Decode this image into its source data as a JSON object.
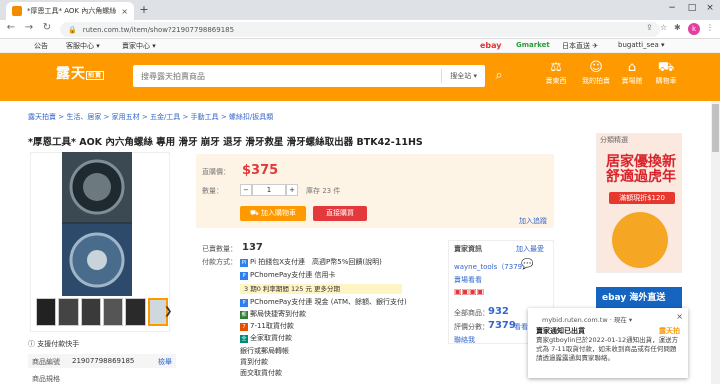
{
  "browser": {
    "tab_title": "*厚恩工具* AOK 內六角螺絲 專用",
    "tab_close": "×",
    "new_tab": "+",
    "url": "ruten.com.tw/item/show?21907798869185",
    "profile_initial": "k",
    "win_min": "−",
    "win_max": "□",
    "win_close": "×"
  },
  "topbar": {
    "links": [
      "公告",
      "客服中心 ▾",
      "賣家中心 ▾"
    ],
    "partners": [
      "ebay",
      "Gmarket",
      "日本直送 ✈",
      "bugatti_sea ▾"
    ]
  },
  "header": {
    "logo": "露天",
    "logo_tag": "拍賣",
    "search_placeholder": "搜尋露天拍賣商品",
    "search_scope": "搜全站 ▾",
    "nav": [
      {
        "icon": "gavel-icon",
        "glyph": "⚖",
        "label": "賣東西"
      },
      {
        "icon": "user-icon",
        "glyph": "☺",
        "label": "我的拍賣"
      },
      {
        "icon": "store-icon",
        "glyph": "⌂",
        "label": "賣場館"
      },
      {
        "icon": "cart-icon",
        "glyph": "⛟",
        "label": "購物車"
      }
    ]
  },
  "breadcrumb": "露天拍賣 > 生活、居家 > 家用五材 > 五金/工具 > 手動工具 > 螺絲扣/扳具類",
  "product": {
    "title": "*厚恩工具* AOK 內六角螺絲 專用 滑牙 崩牙 退牙 滑牙救星 滑牙螺絲取出器 BTK42-11HS",
    "price_label": "直購價：",
    "price": "$375",
    "qty_label": "數量：",
    "qty_minus": "−",
    "qty_value": "1",
    "qty_plus": "+",
    "stock": "庫存 23 件",
    "add_cart": "加入購物車",
    "buy_now": "直接購買",
    "track": "加入追蹤",
    "sold_label": "已賣數量：",
    "sold": "137",
    "pay_label": "付款方式：",
    "payments": [
      "Pi 拍錢包X支付連　高週P幣5%回饋(說明)",
      "PChomePay支付連 信用卡",
      "PChomePay支付連 現金 (ATM、餘額、銀行支付)",
      "郵局快捷寄到付款",
      "7-11取貨付款",
      "全家取貨付款",
      "銀行或郵局轉帳",
      "貨到付款",
      "面交取貨付款"
    ],
    "installment": "3 期0 利率期間 125 元 更多分期",
    "support": "支援付款快手",
    "item_no_label": "商品編號",
    "item_no": "21907798869185",
    "report": "檢舉",
    "spec_label": "商品規格"
  },
  "seller": {
    "title": "賣家資訊",
    "add_fav": "加入最愛",
    "name": "wayne_tools（7379）",
    "reviews": "賣場看看",
    "total_label": "全部商品：",
    "total": "932",
    "rating_label": "評價分數：",
    "rating": "7379",
    "rating_link": "看看評",
    "contact": "聯絡我"
  },
  "ads": {
    "header": "分類精選",
    "headline": "居家優換新 舒適過虎年",
    "coupon": "滿額現折$120",
    "banner2": "ebay 海外直送"
  },
  "notification": {
    "source": "mybid.ruten.com.tw · 現在 ▾",
    "title": "賣家通知已出貨",
    "body": "賣家gtboylin已於2022-01-12通知出貨，運送方式為 7-11取貨付款，如未收到商品或有任何問題請透過露露通與賣家聯絡。",
    "logo": "露天拍",
    "close": "×"
  },
  "colors": {
    "brand_orange": "#ff9900",
    "price_red": "#e4393c",
    "link_blue": "#3366cc"
  }
}
